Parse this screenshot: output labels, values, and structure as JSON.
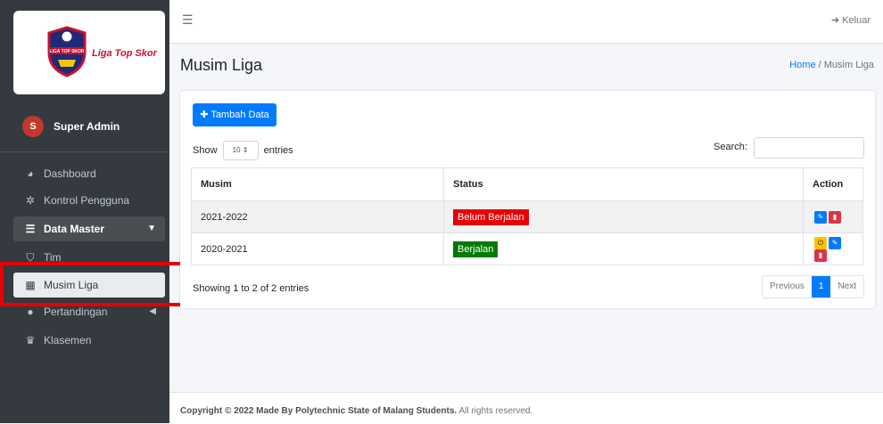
{
  "brand": {
    "name": "Liga Top Skor",
    "logo_text": "LIGA TOP SKOR"
  },
  "user": {
    "initial": "S",
    "name": "Super Admin"
  },
  "nav": [
    {
      "label": "Dashboard",
      "icon": "dashboard-icon"
    },
    {
      "label": "Kontrol Pengguna",
      "icon": "users-cog-icon"
    },
    {
      "label": "Data Master",
      "icon": "database-icon"
    },
    {
      "label": "Tim",
      "icon": "shield-icon"
    },
    {
      "label": "Musim Liga",
      "icon": "calendar-icon"
    },
    {
      "label": "Pertandingan",
      "icon": "soccer-ball-icon"
    },
    {
      "label": "Klasemen",
      "icon": "trophy-icon"
    }
  ],
  "topbar": {
    "logout": "Keluar"
  },
  "page": {
    "title": "Musim Liga",
    "breadcrumb_home": "Home",
    "breadcrumb_sep": "/",
    "breadcrumb_current": "Musim Liga"
  },
  "table": {
    "add_label": "Tambah Data",
    "show_label": "Show",
    "entries_label": "entries",
    "length_value": "10",
    "search_label": "Search:",
    "headers": [
      "Musim",
      "Status",
      "Action"
    ],
    "rows": [
      {
        "musim": "2021-2022",
        "status": "Belum Berjalan"
      },
      {
        "musim": "2020-2021",
        "status": "Berjalan"
      }
    ],
    "info": "Showing 1 to 2 of 2 entries",
    "pager": {
      "prev": "Previous",
      "current": "1",
      "next": "Next"
    }
  },
  "footer": {
    "copyright": "Copyright © 2022 Made By Polytechnic State of Malang Students.",
    "rights": "All rights reserved."
  },
  "colors": {
    "sidebar": "#343a40",
    "primary": "#007bff",
    "danger": "#e60000",
    "success": "#007a00",
    "highlight": "#e60000"
  }
}
